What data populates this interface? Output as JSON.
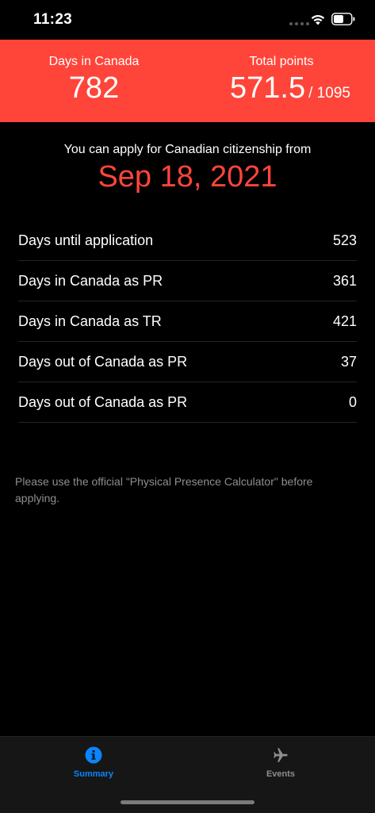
{
  "status_bar": {
    "time": "11:23"
  },
  "header": {
    "days_label": "Days in Canada",
    "days_value": "782",
    "points_label": "Total points",
    "points_value": "571.5",
    "points_total": "/ 1095",
    "background_color": "#ff453a"
  },
  "apply": {
    "label": "You can apply for Canadian citizenship from",
    "date": "Sep 18, 2021",
    "accent_color": "#ff453a"
  },
  "details": [
    {
      "label": "Days until application",
      "value": "523"
    },
    {
      "label": "Days in Canada as PR",
      "value": "361"
    },
    {
      "label": "Days in Canada as TR",
      "value": "421"
    },
    {
      "label": "Days out of Canada as PR",
      "value": "37"
    },
    {
      "label": "Days out of Canada as PR",
      "value": "0"
    }
  ],
  "disclaimer": "Please use the official \"Physical Presence Calculator\" before applying.",
  "tab_bar": {
    "tabs": [
      {
        "label": "Summary",
        "icon": "info-icon",
        "active": true
      },
      {
        "label": "Events",
        "icon": "airplane-icon",
        "active": false
      }
    ],
    "active_color": "#0a84ff",
    "inactive_color": "#8e8e93"
  }
}
